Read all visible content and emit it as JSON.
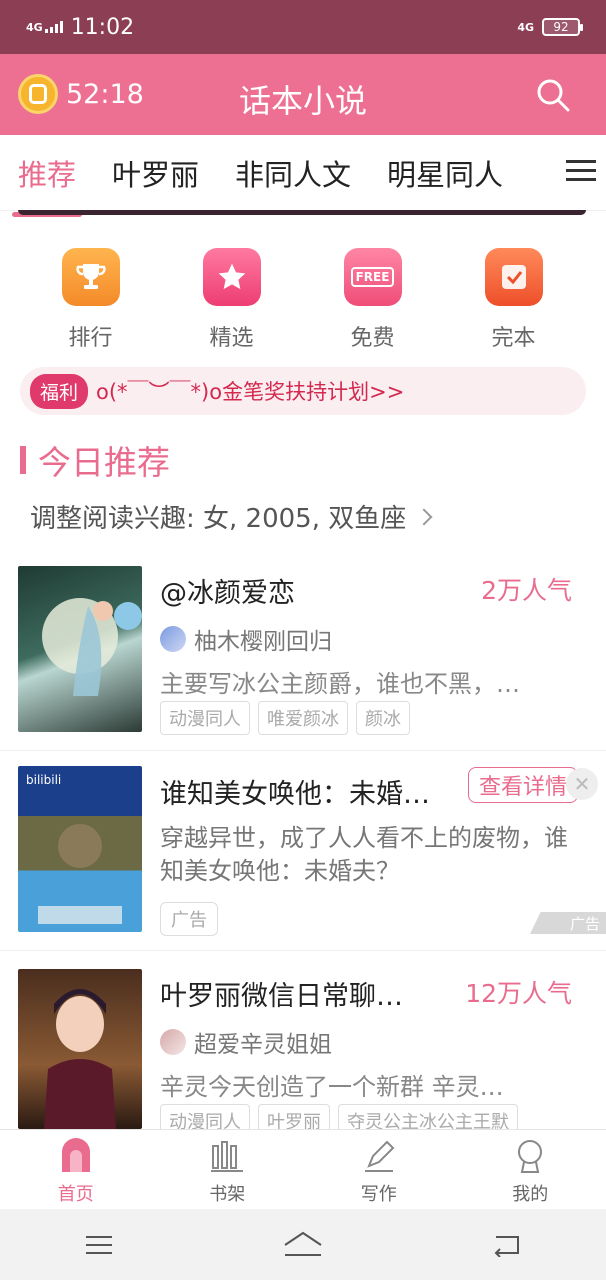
{
  "status_bar": {
    "network": "4G",
    "time": "11:02",
    "network_right": "4G",
    "battery": "92"
  },
  "header": {
    "timer": "52:18",
    "title": "话本小说"
  },
  "tabs": [
    "推荐",
    "叶罗丽",
    "非同人文",
    "明星同人"
  ],
  "quick_nav": [
    {
      "label": "排行",
      "icon": "trophy-icon",
      "color": "#f7a23b"
    },
    {
      "label": "精选",
      "icon": "star-icon",
      "color": "#f05a85"
    },
    {
      "label": "免费",
      "icon": "free-icon",
      "color": "#f36687",
      "badge": "FREE"
    },
    {
      "label": "完本",
      "icon": "check-icon",
      "color": "#f46b3f"
    }
  ],
  "welfare": {
    "badge": "福利",
    "text": "o(*￣︶￣*)o金笔奖扶持计划>>"
  },
  "section": {
    "title": "今日推荐"
  },
  "interest": {
    "text": "调整阅读兴趣: 女, 2005, 双鱼座"
  },
  "books": [
    {
      "title": "@冰颜爱恋",
      "popularity": "2万人气",
      "author": "柚木樱刚回归",
      "desc": "主要写冰公主颜爵，谁也不黑，…",
      "tags": [
        "动漫同人",
        "唯爱颜冰",
        "颜冰"
      ]
    },
    {
      "title": "叶罗丽微信日常聊…",
      "popularity": "12万人气",
      "author": "超爱辛灵姐姐",
      "desc": "辛灵今天创造了一个新群 辛灵…",
      "tags": [
        "动漫同人",
        "叶罗丽",
        "夺灵公主冰公主王默"
      ]
    }
  ],
  "ad": {
    "title": "谁知美女唤他：未婚…",
    "button": "查看详情",
    "close": "✕",
    "desc": "穿越异世，成了人人看不上的废物，谁知美女唤他：未婚夫？",
    "tag": "广告",
    "mark": "广告"
  },
  "bottom_nav": [
    {
      "label": "首页",
      "icon": "home-icon"
    },
    {
      "label": "书架",
      "icon": "bookshelf-icon"
    },
    {
      "label": "写作",
      "icon": "pen-icon"
    },
    {
      "label": "我的",
      "icon": "profile-icon"
    }
  ],
  "colors": {
    "accent": "#e96c8f",
    "header_bg": "#ed6f91",
    "status_bg": "#8c3e55"
  }
}
